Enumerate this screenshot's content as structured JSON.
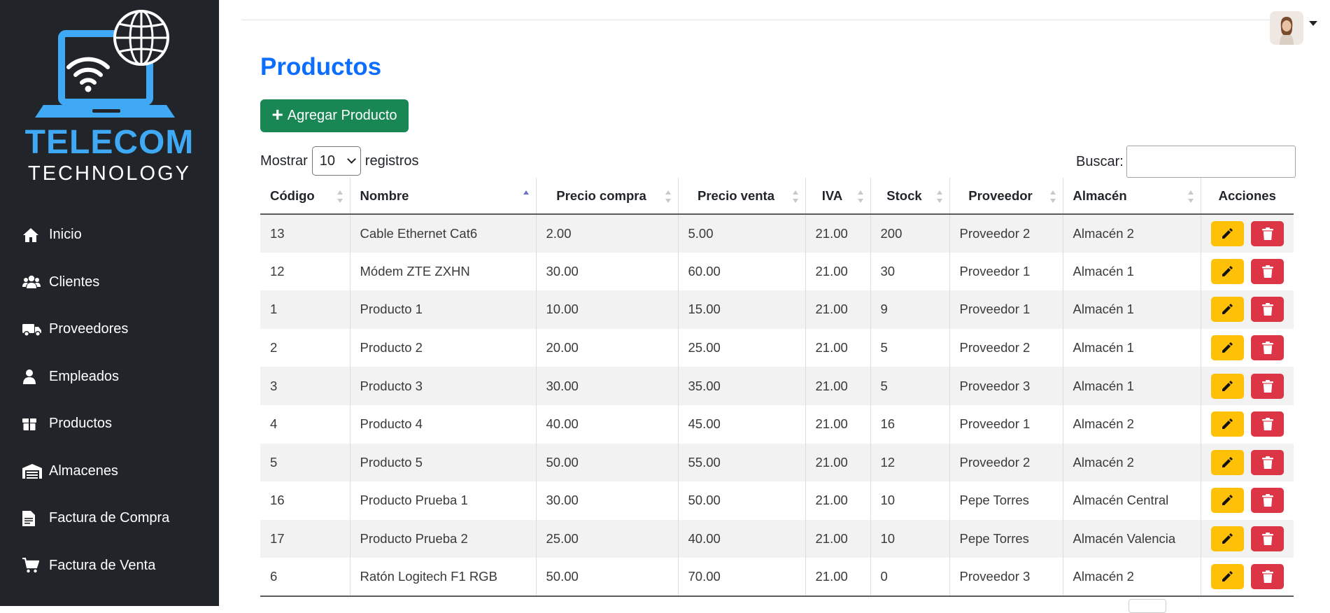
{
  "brand": {
    "line1": "TELECOM",
    "line2": "TECHNOLOGY"
  },
  "sidebar": {
    "items": [
      {
        "label": "Inicio",
        "icon": "home-icon"
      },
      {
        "label": "Clientes",
        "icon": "users-icon"
      },
      {
        "label": "Proveedores",
        "icon": "truck-icon"
      },
      {
        "label": "Empleados",
        "icon": "user-icon"
      },
      {
        "label": "Productos",
        "icon": "box-icon"
      },
      {
        "label": "Almacenes",
        "icon": "warehouse-icon"
      },
      {
        "label": "Factura de Compra",
        "icon": "invoice-icon"
      },
      {
        "label": "Factura de Venta",
        "icon": "cart-icon"
      }
    ]
  },
  "page": {
    "title": "Productos",
    "add_button": "Agregar Producto"
  },
  "length_control": {
    "prefix": "Mostrar",
    "value": "10",
    "suffix": "registros"
  },
  "search": {
    "label": "Buscar:",
    "value": ""
  },
  "table": {
    "headers": [
      "Código",
      "Nombre",
      "Precio compra",
      "Precio venta",
      "IVA",
      "Stock",
      "Proveedor",
      "Almacén",
      "Acciones"
    ],
    "sorted_column": "Nombre",
    "sort_direction": "asc",
    "rows": [
      [
        "13",
        "Cable Ethernet Cat6",
        "2.00",
        "5.00",
        "21.00",
        "200",
        "Proveedor 2",
        "Almacén 2"
      ],
      [
        "12",
        "Módem ZTE ZXHN",
        "30.00",
        "60.00",
        "21.00",
        "30",
        "Proveedor 1",
        "Almacén 1"
      ],
      [
        "1",
        "Producto 1",
        "10.00",
        "15.00",
        "21.00",
        "9",
        "Proveedor 1",
        "Almacén 1"
      ],
      [
        "2",
        "Producto 2",
        "20.00",
        "25.00",
        "21.00",
        "5",
        "Proveedor 2",
        "Almacén 1"
      ],
      [
        "3",
        "Producto 3",
        "30.00",
        "35.00",
        "21.00",
        "5",
        "Proveedor 3",
        "Almacén 1"
      ],
      [
        "4",
        "Producto 4",
        "40.00",
        "45.00",
        "21.00",
        "16",
        "Proveedor 1",
        "Almacén 2"
      ],
      [
        "5",
        "Producto 5",
        "50.00",
        "55.00",
        "21.00",
        "12",
        "Proveedor 2",
        "Almacén 2"
      ],
      [
        "16",
        "Producto Prueba 1",
        "30.00",
        "50.00",
        "21.00",
        "10",
        "Pepe Torres",
        "Almacén Central"
      ],
      [
        "17",
        "Producto Prueba 2",
        "25.00",
        "40.00",
        "21.00",
        "10",
        "Pepe Torres",
        "Almacén Valencia"
      ],
      [
        "6",
        "Ratón Logitech F1 RGB",
        "50.00",
        "70.00",
        "21.00",
        "0",
        "Proveedor 3",
        "Almacén 2"
      ]
    ]
  },
  "colors": {
    "sidebar_bg": "#212529",
    "title": "#0d6efd",
    "add_button": "#198754",
    "edit_button": "#ffc107",
    "delete_button": "#dc3545",
    "logo_blue": "#3fa9f5"
  }
}
